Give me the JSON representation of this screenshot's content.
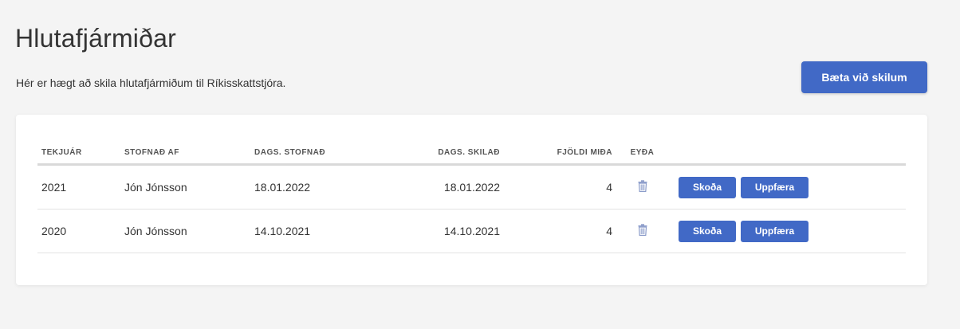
{
  "header": {
    "title": "Hlutafjármiðar",
    "subtitle": "Hér er hægt að skila hlutafjármiðum til Ríkisskattstjóra.",
    "add_button": "Bæta við skilum"
  },
  "table": {
    "columns": {
      "year": "TEKJUÁR",
      "created_by": "STOFNAÐ AF",
      "date_created": "DAGS. STOFNAÐ",
      "date_filed": "DAGS. SKILAÐ",
      "count": "FJÖLDI MIÐA",
      "delete": "EYÐA"
    },
    "rows": [
      {
        "year": "2021",
        "created_by": "Jón Jónsson",
        "date_created": "18.01.2022",
        "date_filed": "18.01.2022",
        "count": "4",
        "view_label": "Skoða",
        "update_label": "Uppfæra",
        "delete_icon": "trash-icon"
      },
      {
        "year": "2020",
        "created_by": "Jón Jónsson",
        "date_created": "14.10.2021",
        "date_filed": "14.10.2021",
        "count": "4",
        "view_label": "Skoða",
        "update_label": "Uppfæra",
        "delete_icon": "trash-icon"
      }
    ]
  },
  "colors": {
    "accent": "#4169c6",
    "background": "#f4f4f4",
    "card": "#ffffff",
    "trash_icon": "#8a9bc9"
  }
}
